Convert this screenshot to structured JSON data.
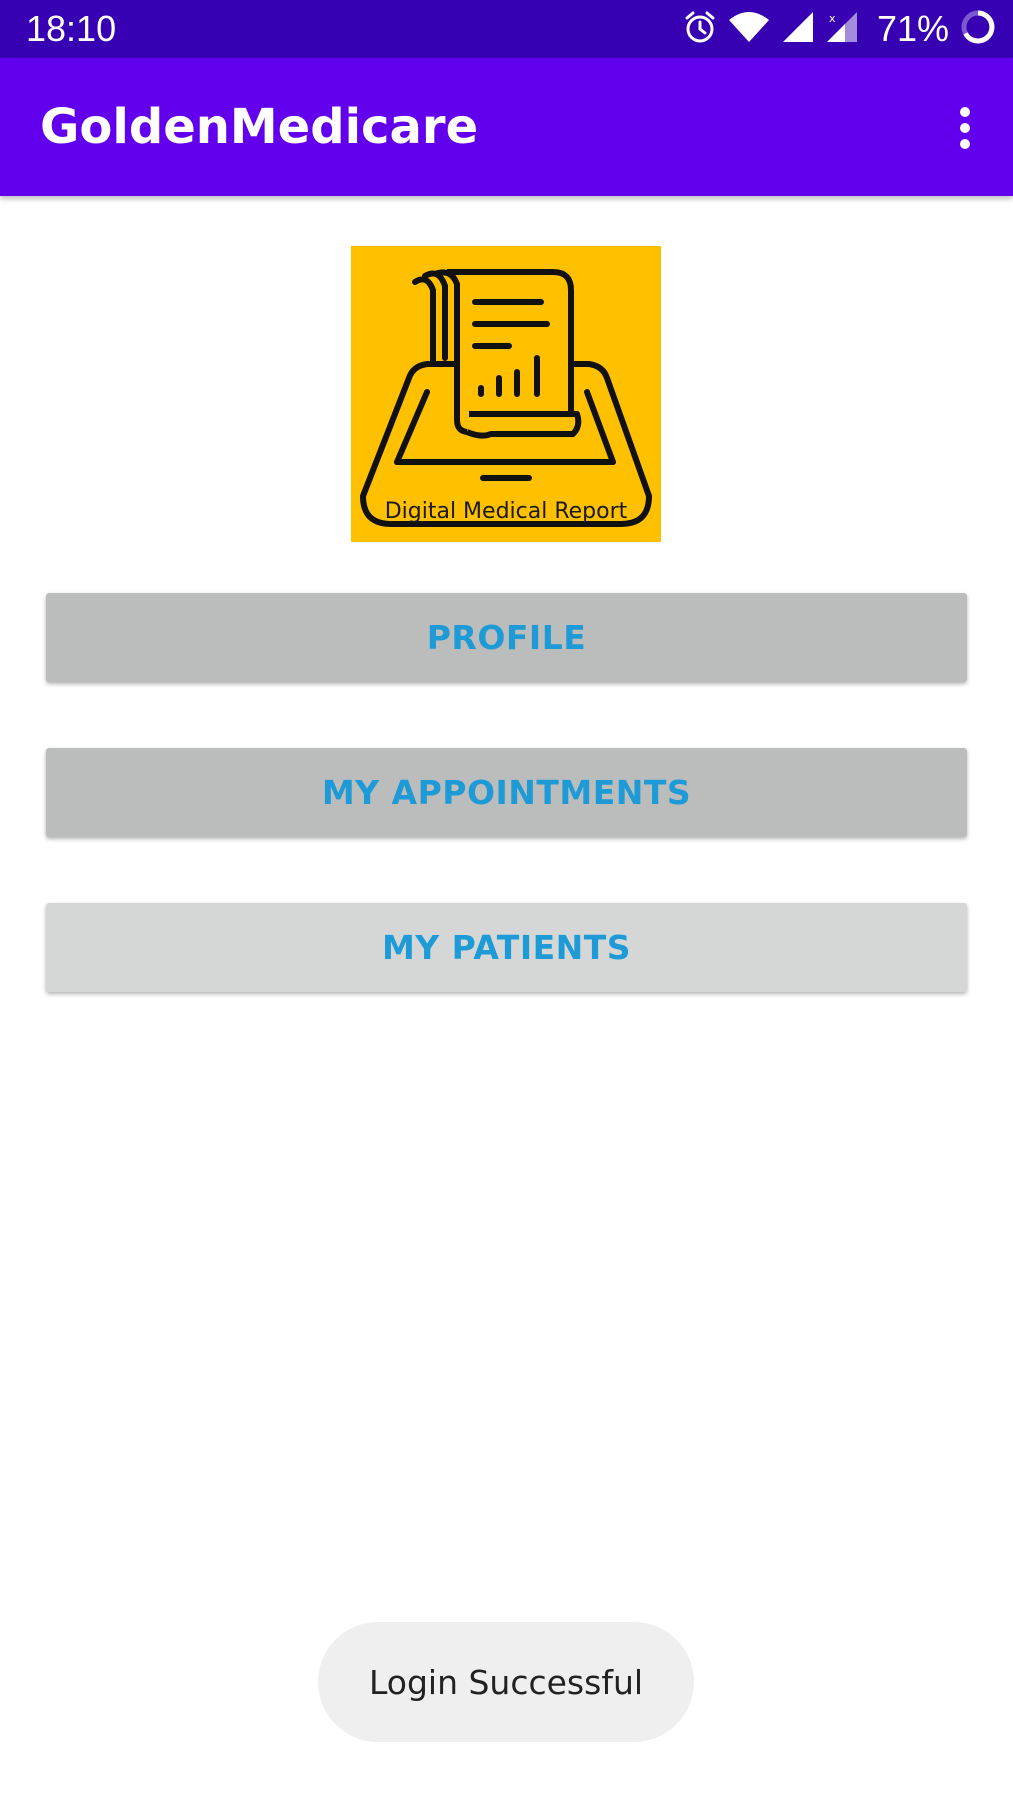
{
  "status_bar": {
    "time": "18:10",
    "battery": "71%",
    "icons": [
      "alarm-icon",
      "wifi-icon",
      "signal-icon",
      "signal-no-data-icon",
      "battery-ring-icon"
    ]
  },
  "app_bar": {
    "title": "GoldenMedicare",
    "menu_icon": "more-vert-icon"
  },
  "logo": {
    "caption": "Digital Medical Report",
    "background": "#ffc000"
  },
  "menu": {
    "profile_label": "PROFILE",
    "appointments_label": "MY APPOINTMENTS",
    "patients_label": "MY PATIENTS"
  },
  "toast": {
    "message": "Login Successful"
  },
  "colors": {
    "status_bar": "#3700b3",
    "app_bar": "#6200ee",
    "button_text": "#1e9bd7",
    "button_bg": "#bbbcbc",
    "button_bg_light": "#d5d7d7"
  }
}
